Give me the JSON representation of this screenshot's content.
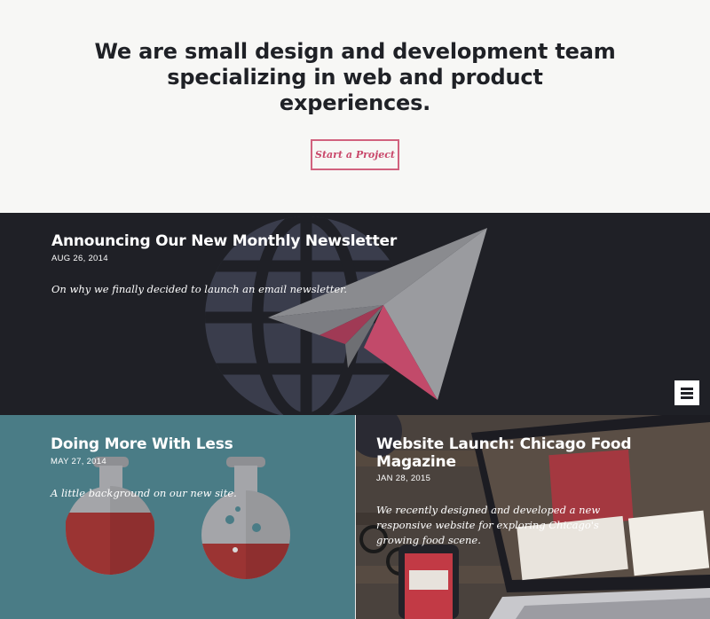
{
  "hero": {
    "title": "We are small design and development team specializing in web and product experiences.",
    "cta_label": "Start a Project"
  },
  "featured_post": {
    "title": "Announcing Our New Monthly Newsletter",
    "date": "AUG 26, 2014",
    "excerpt": "On why we finally decided to launch an email newsletter.",
    "background_color": "#1f2026",
    "illustration": "paper-airplane-globe-icon"
  },
  "menu": {
    "icon": "hamburger-menu-icon"
  },
  "posts": [
    {
      "title": "Doing More With Less",
      "date": "MAY 27, 2014",
      "excerpt": "A little background on our new site.",
      "background_color": "#4a7c86",
      "illustration": "flask-icon"
    },
    {
      "title": "Website Launch: Chicago Food Magazine",
      "date": "JAN 28, 2015",
      "excerpt": "We recently designed and developed a new responsive website for exploring Chicago's growing food scene.",
      "illustration": "laptop-phone-photo"
    }
  ],
  "colors": {
    "accent": "#c9486b",
    "dark": "#1f2026",
    "teal": "#4a7c86"
  }
}
